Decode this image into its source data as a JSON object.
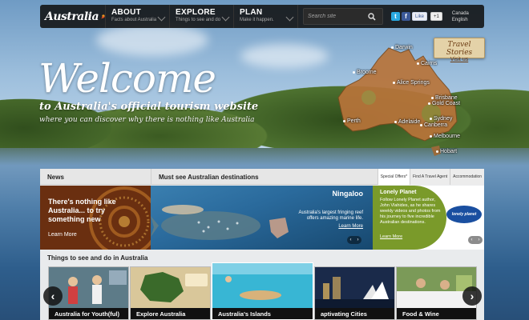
{
  "nav": {
    "logo_text": "Australia",
    "items": [
      {
        "title": "ABOUT",
        "sub": "Facts about Australia"
      },
      {
        "title": "EXPLORE",
        "sub": "Things to see and do"
      },
      {
        "title": "PLAN",
        "sub": "Make it happen."
      }
    ],
    "search_placeholder": "Search site",
    "social": {
      "twitter": "t",
      "facebook": "f",
      "like": "Like",
      "plus": "+1"
    },
    "region": {
      "country": "Canada",
      "language": "English"
    }
  },
  "hero": {
    "title": "Welcome",
    "subtitle": "to Australia's official tourism website",
    "tagline": "where you can discover why there is nothing like Australia"
  },
  "map": {
    "cities": [
      "Darwin",
      "Cairns",
      "Broome",
      "Alice Springs",
      "Brisbane",
      "Gold Coast",
      "Perth",
      "Adelaide",
      "Sydney",
      "Canberra",
      "Melbourne",
      "Hobart"
    ],
    "land_color": "#b8743a",
    "travel_stories": {
      "title": "Travel Stories",
      "link": "Visit us"
    }
  },
  "panel": {
    "news_header": "News",
    "must_see_header": "Must see Australian destinations",
    "tabs": [
      "Special Offers*",
      "Find A Travel Agent",
      "Accommodation"
    ],
    "news": {
      "headline": "There's nothing like Australia... to try something new",
      "more": "Learn More"
    },
    "ningaloo": {
      "title": "Ningaloo",
      "description": "Australia's largest fringing reef offers amazing marine life.",
      "more": "Learn More"
    },
    "lonely_planet": {
      "title": "Lonely Planet",
      "description": "Follow Lonely Planet author, John Vlahides, as he shares weekly videos and photos from his journey to five incredible Australian destinations.",
      "more": "Learn More",
      "badge": "lonely planet"
    },
    "things_header": "Things to see and do in Australia",
    "cards": [
      {
        "caption": "Australia for Youth(ful)",
        "color": "#4a6a3a"
      },
      {
        "caption": "Explore Australia",
        "color": "#c9b27a"
      },
      {
        "caption": "Australia's Islands",
        "color": "#3aa6c9"
      },
      {
        "caption": "aptivating Cities",
        "color": "#14213a"
      },
      {
        "caption": "Food & Wine",
        "color": "#6c8a4a"
      }
    ]
  },
  "colors": {
    "nav_bg": "#111111",
    "accent_green": "#7a9a2a",
    "news_bg": "#6a2f10"
  }
}
